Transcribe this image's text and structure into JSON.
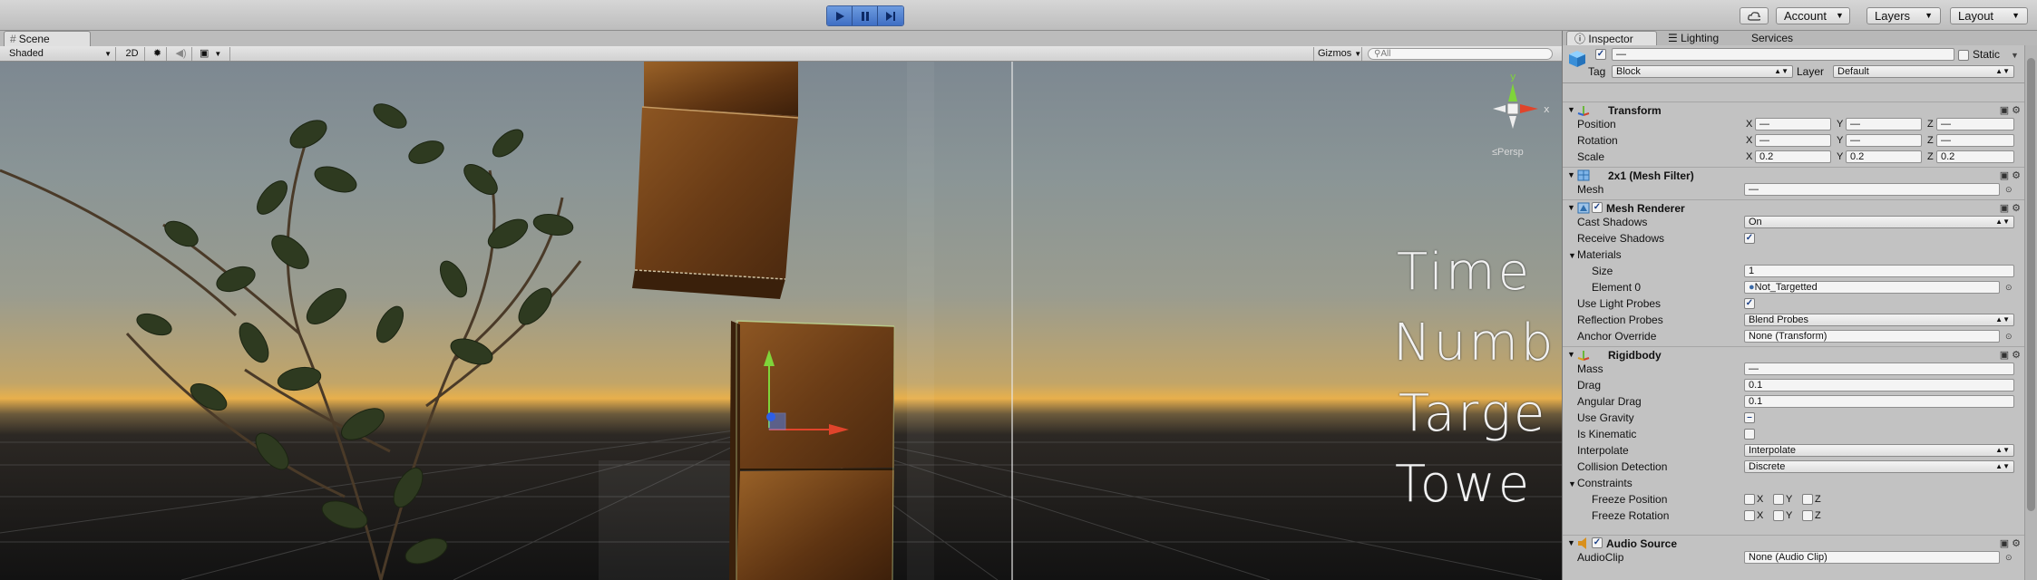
{
  "toolbar": {
    "play_icon": "play-icon",
    "pause_icon": "pause-icon",
    "step_icon": "step-icon",
    "cloud_icon": "cloud-icon",
    "account": "Account",
    "layers": "Layers",
    "layout": "Layout"
  },
  "scene": {
    "tab_label": "Scene",
    "shading_mode": "Shaded",
    "mode_2d": "2D",
    "gizmos": "Gizmos",
    "search_placeholder": "All",
    "persp_label": "Persp",
    "overlay_lines": [
      "Time",
      "Numb",
      "Targe",
      "Towe"
    ]
  },
  "inspector": {
    "tabs": {
      "inspector": "Inspector",
      "lighting": "Lighting",
      "services": "Services"
    },
    "object_name": "—",
    "static_label": "Static",
    "tag_label": "Tag",
    "tag_value": "Block",
    "layer_label": "Layer",
    "layer_value": "Default",
    "transform": {
      "title": "Transform",
      "position_label": "Position",
      "rotation_label": "Rotation",
      "scale_label": "Scale",
      "position": {
        "x": "—",
        "y": "—",
        "z": "—"
      },
      "rotation": {
        "x": "—",
        "y": "—",
        "z": "—"
      },
      "scale": {
        "x": "0.2",
        "y": "0.2",
        "z": "0.2"
      },
      "axis_x": "X",
      "axis_y": "Y",
      "axis_z": "Z"
    },
    "mesh_filter": {
      "title": "2x1 (Mesh Filter)",
      "mesh_label": "Mesh",
      "mesh_value": "—"
    },
    "mesh_renderer": {
      "title": "Mesh Renderer",
      "cast_shadows_label": "Cast Shadows",
      "cast_shadows_value": "On",
      "receive_shadows_label": "Receive Shadows",
      "materials_label": "Materials",
      "size_label": "Size",
      "size_value": "1",
      "element0_label": "Element 0",
      "element0_value": "Not_Targetted",
      "light_probes_label": "Use Light Probes",
      "reflection_probes_label": "Reflection Probes",
      "reflection_probes_value": "Blend Probes",
      "anchor_override_label": "Anchor Override",
      "anchor_override_value": "None (Transform)"
    },
    "rigidbody": {
      "title": "Rigidbody",
      "mass_label": "Mass",
      "mass_value": "—",
      "drag_label": "Drag",
      "drag_value": "0.1",
      "angular_drag_label": "Angular Drag",
      "angular_drag_value": "0.1",
      "use_gravity_label": "Use Gravity",
      "is_kinematic_label": "Is Kinematic",
      "interpolate_label": "Interpolate",
      "interpolate_value": "Interpolate",
      "collision_label": "Collision Detection",
      "collision_value": "Discrete",
      "constraints_label": "Constraints",
      "freeze_pos_label": "Freeze Position",
      "freeze_rot_label": "Freeze Rotation"
    },
    "audio_source": {
      "title": "Audio Source",
      "clip_label": "AudioClip",
      "clip_value": "None (Audio Clip)"
    }
  },
  "colors": {
    "play_active": "#4f80d6",
    "panel_bg": "#c2c2c2",
    "checkbox_mark": "#1b3f86",
    "wood": "#7a4518"
  }
}
